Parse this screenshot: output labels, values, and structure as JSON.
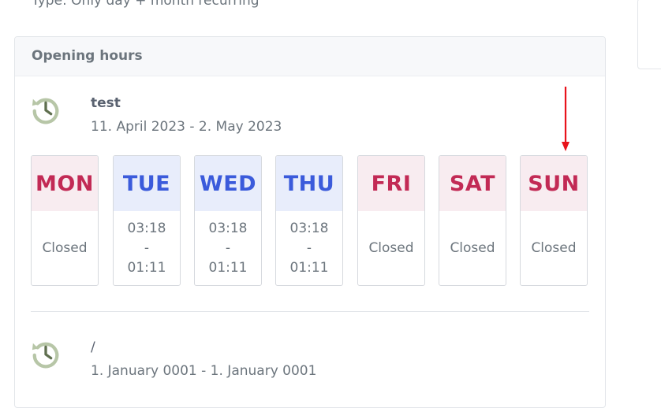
{
  "top_text": "Type: Only day + month recurring",
  "card": {
    "title": "Opening hours"
  },
  "entries": [
    {
      "title": "test",
      "range": "11. April 2023 - 2. May 2023",
      "icon": "history-clock-icon",
      "days": [
        {
          "label": "MON",
          "status": "closed",
          "text": "Closed"
        },
        {
          "label": "TUE",
          "status": "open",
          "from": "03:18",
          "sep": "-",
          "to": "01:11"
        },
        {
          "label": "WED",
          "status": "open",
          "from": "03:18",
          "sep": "-",
          "to": "01:11"
        },
        {
          "label": "THU",
          "status": "open",
          "from": "03:18",
          "sep": "-",
          "to": "01:11"
        },
        {
          "label": "FRI",
          "status": "closed",
          "text": "Closed"
        },
        {
          "label": "SAT",
          "status": "closed",
          "text": "Closed"
        },
        {
          "label": "SUN",
          "status": "closed",
          "text": "Closed"
        }
      ]
    },
    {
      "title": "/",
      "range": "1. January 0001 - 1. January 0001",
      "icon": "history-clock-icon"
    }
  ],
  "annotation": {
    "type": "arrow",
    "color": "#e8131b",
    "target": "SUN"
  },
  "colors": {
    "closed_bg": "#f8ecf0",
    "closed_text": "#c22a55",
    "open_bg": "#e8edfb",
    "open_text": "#3b5bdb",
    "icon": "#b7c6a7"
  }
}
